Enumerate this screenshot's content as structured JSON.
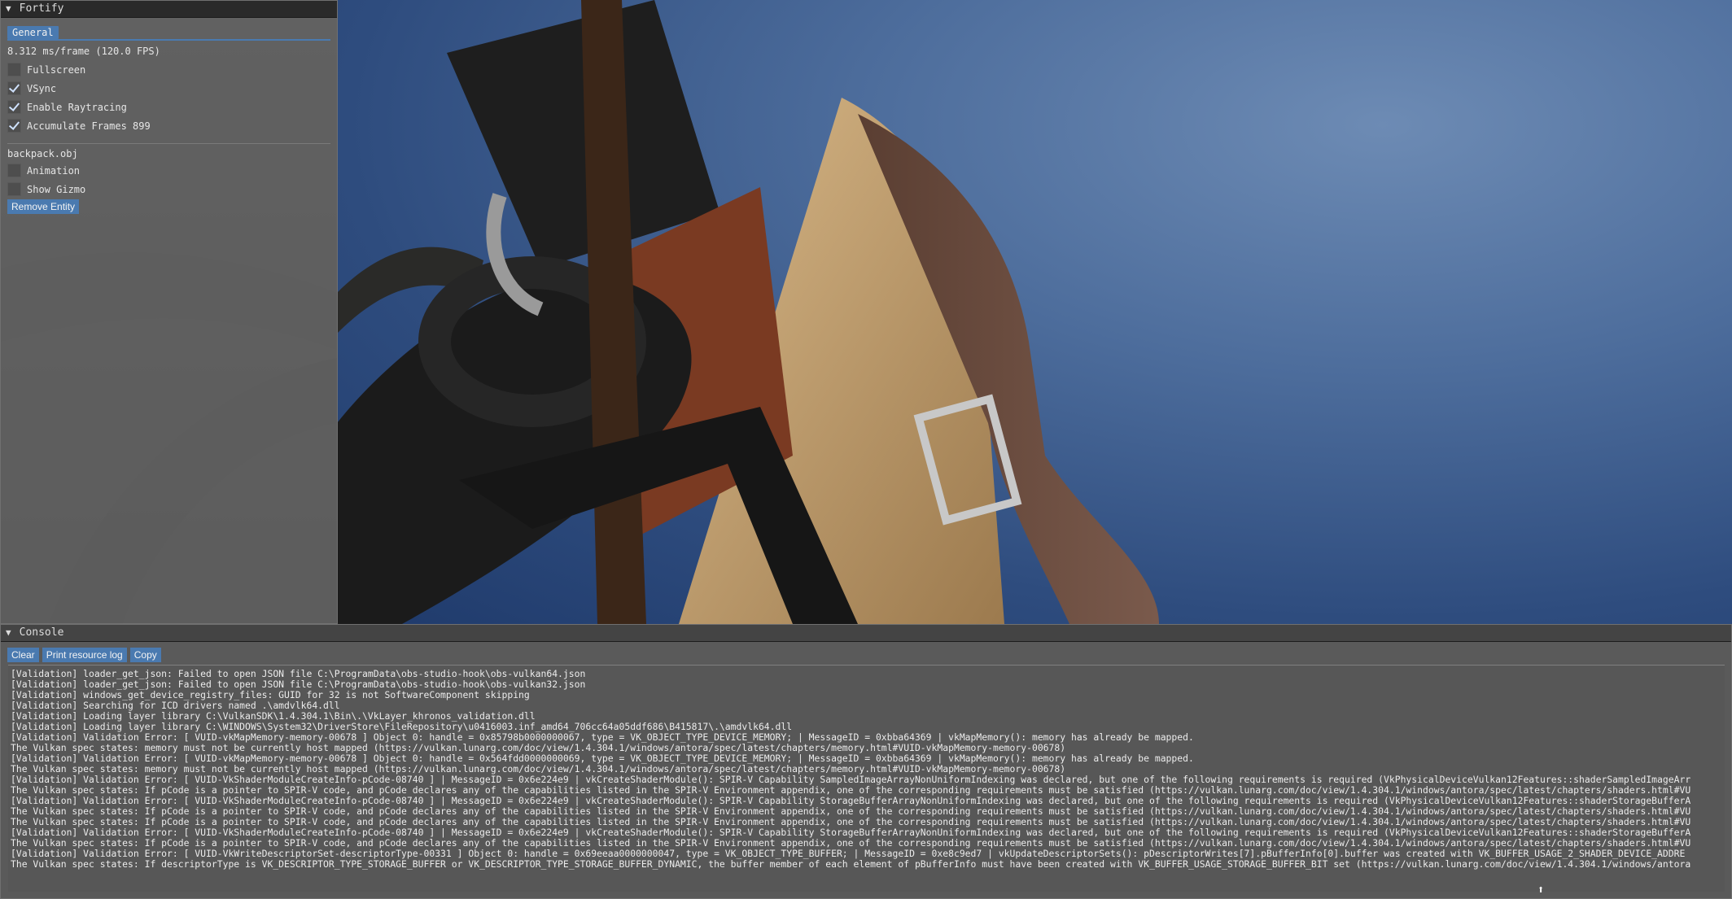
{
  "fortify": {
    "title": "Fortify",
    "tab_label": "General",
    "frame_stats": "8.312 ms/frame (120.0 FPS)",
    "options": [
      {
        "label": "Fullscreen",
        "checked": false
      },
      {
        "label": "VSync",
        "checked": true
      },
      {
        "label": "Enable Raytracing",
        "checked": true
      },
      {
        "label": "Accumulate Frames 899",
        "checked": true
      }
    ],
    "entity_name": "backpack.obj",
    "entity_options": [
      {
        "label": "Animation",
        "checked": false
      },
      {
        "label": "Show Gizmo",
        "checked": false
      }
    ],
    "remove_button": "Remove Entity"
  },
  "console": {
    "title": "Console",
    "buttons": {
      "clear": "Clear",
      "print_resource_log": "Print resource log",
      "copy": "Copy"
    },
    "lines": [
      "[Validation] loader_get_json: Failed to open JSON file C:\\ProgramData\\obs-studio-hook\\obs-vulkan64.json",
      "[Validation] loader_get_json: Failed to open JSON file C:\\ProgramData\\obs-studio-hook\\obs-vulkan32.json",
      "[Validation] windows_get_device_registry_files: GUID for 32 is not SoftwareComponent skipping",
      "[Validation] Searching for ICD drivers named .\\amdvlk64.dll",
      "[Validation] Loading layer library C:\\VulkanSDK\\1.4.304.1\\Bin\\.\\VkLayer_khronos_validation.dll",
      "[Validation] Loading layer library C:\\WINDOWS\\System32\\DriverStore\\FileRepository\\u0416003.inf_amd64_706cc64a05ddf686\\B415817\\.\\amdvlk64.dll",
      "[Validation] Validation Error: [ VUID-vkMapMemory-memory-00678 ] Object 0: handle = 0x85798b0000000067, type = VK_OBJECT_TYPE_DEVICE_MEMORY; | MessageID = 0xbba64369 | vkMapMemory(): memory has already be mapped.",
      "The Vulkan spec states: memory must not be currently host mapped (https://vulkan.lunarg.com/doc/view/1.4.304.1/windows/antora/spec/latest/chapters/memory.html#VUID-vkMapMemory-memory-00678)",
      "[Validation] Validation Error: [ VUID-vkMapMemory-memory-00678 ] Object 0: handle = 0x564fdd0000000069, type = VK_OBJECT_TYPE_DEVICE_MEMORY; | MessageID = 0xbba64369 | vkMapMemory(): memory has already be mapped.",
      "The Vulkan spec states: memory must not be currently host mapped (https://vulkan.lunarg.com/doc/view/1.4.304.1/windows/antora/spec/latest/chapters/memory.html#VUID-vkMapMemory-memory-00678)",
      "[Validation] Validation Error: [ VUID-VkShaderModuleCreateInfo-pCode-08740 ] | MessageID = 0x6e224e9 | vkCreateShaderModule(): SPIR-V Capability SampledImageArrayNonUniformIndexing was declared, but one of the following requirements is required (VkPhysicalDeviceVulkan12Features::shaderSampledImageArr",
      "The Vulkan spec states: If pCode is a pointer to SPIR-V code, and pCode declares any of the capabilities listed in the SPIR-V Environment appendix, one of the corresponding requirements must be satisfied (https://vulkan.lunarg.com/doc/view/1.4.304.1/windows/antora/spec/latest/chapters/shaders.html#VU",
      "[Validation] Validation Error: [ VUID-VkShaderModuleCreateInfo-pCode-08740 ] | MessageID = 0x6e224e9 | vkCreateShaderModule(): SPIR-V Capability StorageBufferArrayNonUniformIndexing was declared, but one of the following requirements is required (VkPhysicalDeviceVulkan12Features::shaderStorageBufferA",
      "The Vulkan spec states: If pCode is a pointer to SPIR-V code, and pCode declares any of the capabilities listed in the SPIR-V Environment appendix, one of the corresponding requirements must be satisfied (https://vulkan.lunarg.com/doc/view/1.4.304.1/windows/antora/spec/latest/chapters/shaders.html#VU",
      "The Vulkan spec states: If pCode is a pointer to SPIR-V code, and pCode declares any of the capabilities listed in the SPIR-V Environment appendix, one of the corresponding requirements must be satisfied (https://vulkan.lunarg.com/doc/view/1.4.304.1/windows/antora/spec/latest/chapters/shaders.html#VU",
      "[Validation] Validation Error: [ VUID-VkShaderModuleCreateInfo-pCode-08740 ] | MessageID = 0x6e224e9 | vkCreateShaderModule(): SPIR-V Capability StorageBufferArrayNonUniformIndexing was declared, but one of the following requirements is required (VkPhysicalDeviceVulkan12Features::shaderStorageBufferA",
      "The Vulkan spec states: If pCode is a pointer to SPIR-V code, and pCode declares any of the capabilities listed in the SPIR-V Environment appendix, one of the corresponding requirements must be satisfied (https://vulkan.lunarg.com/doc/view/1.4.304.1/windows/antora/spec/latest/chapters/shaders.html#VU",
      "[Validation] Validation Error: [ VUID-VkWriteDescriptorSet-descriptorType-00331 ] Object 0: handle = 0x69eeaa0000000047, type = VK_OBJECT_TYPE_BUFFER; | MessageID = 0xe8c9ed7 | vkUpdateDescriptorSets(): pDescriptorWrites[7].pBufferInfo[0].buffer was created with VK_BUFFER_USAGE_2_SHADER_DEVICE_ADDRE",
      "The Vulkan spec states: If descriptorType is VK_DESCRIPTOR_TYPE_STORAGE_BUFFER or VK_DESCRIPTOR_TYPE_STORAGE_BUFFER_DYNAMIC, the buffer member of each element of pBufferInfo must have been created with VK_BUFFER_USAGE_STORAGE_BUFFER_BIT set (https://vulkan.lunarg.com/doc/view/1.4.304.1/windows/antora"
    ]
  },
  "icons": {
    "collapse_arrow": "triangle-down-icon",
    "checkmark": "checkmark-icon"
  },
  "colors": {
    "accent": "#4a7ab0",
    "panel_bg": "#606060",
    "titlebar_bg": "#2a2a2a",
    "sky": "#3b5a8c"
  }
}
